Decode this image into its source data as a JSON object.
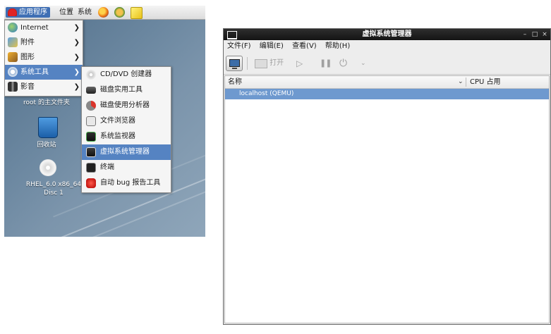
{
  "top_panel": {
    "applications": "应用程序",
    "places": "位置",
    "system": "系统",
    "icons": [
      "redhat-icon",
      "firefox-icon",
      "settings-icon",
      "notes-icon"
    ]
  },
  "main_menu": {
    "items": [
      {
        "label": "Internet",
        "icon": "globe-icon",
        "has_submenu": true
      },
      {
        "label": "附件",
        "icon": "accessories-icon",
        "has_submenu": true
      },
      {
        "label": "图形",
        "icon": "graphics-icon",
        "has_submenu": true
      },
      {
        "label": "系统工具",
        "icon": "system-tools-icon",
        "has_submenu": true,
        "selected": true
      },
      {
        "label": "影音",
        "icon": "multimedia-icon",
        "has_submenu": true
      }
    ]
  },
  "submenu": {
    "items": [
      {
        "label": "CD/DVD 创建器",
        "icon": "cd-icon"
      },
      {
        "label": "磁盘实用工具",
        "icon": "disk-icon"
      },
      {
        "label": "磁盘使用分析器",
        "icon": "disk-usage-icon"
      },
      {
        "label": "文件浏览器",
        "icon": "file-browser-icon"
      },
      {
        "label": "系统监视器",
        "icon": "monitor-icon"
      },
      {
        "label": "虚拟系统管理器",
        "icon": "virt-manager-icon",
        "selected": true
      },
      {
        "label": "终端",
        "icon": "terminal-icon"
      },
      {
        "label": "自动 bug 报告工具",
        "icon": "bug-report-icon"
      }
    ]
  },
  "desktop_icons": [
    {
      "label": "root 的主文件夹"
    },
    {
      "label": "回收站"
    },
    {
      "label": "RHEL_6.0 x86_64",
      "label2": "Disc 1"
    }
  ],
  "window": {
    "title": "虚拟系统管理器",
    "controls": {
      "minimize": "–",
      "maximize": "□",
      "close": "×"
    },
    "menubar": [
      "文件(F)",
      "编辑(E)",
      "查看(V)",
      "帮助(H)"
    ],
    "toolbar": {
      "open_label": "打开"
    },
    "table": {
      "columns": [
        "名称",
        "CPU 占用"
      ],
      "rows": [
        {
          "name": "localhost (QEMU)",
          "selected": true
        }
      ]
    }
  },
  "colors": {
    "selection": "#5583c2",
    "row_selected": "#6e99cf",
    "titlebar": "#1e1e1e"
  }
}
